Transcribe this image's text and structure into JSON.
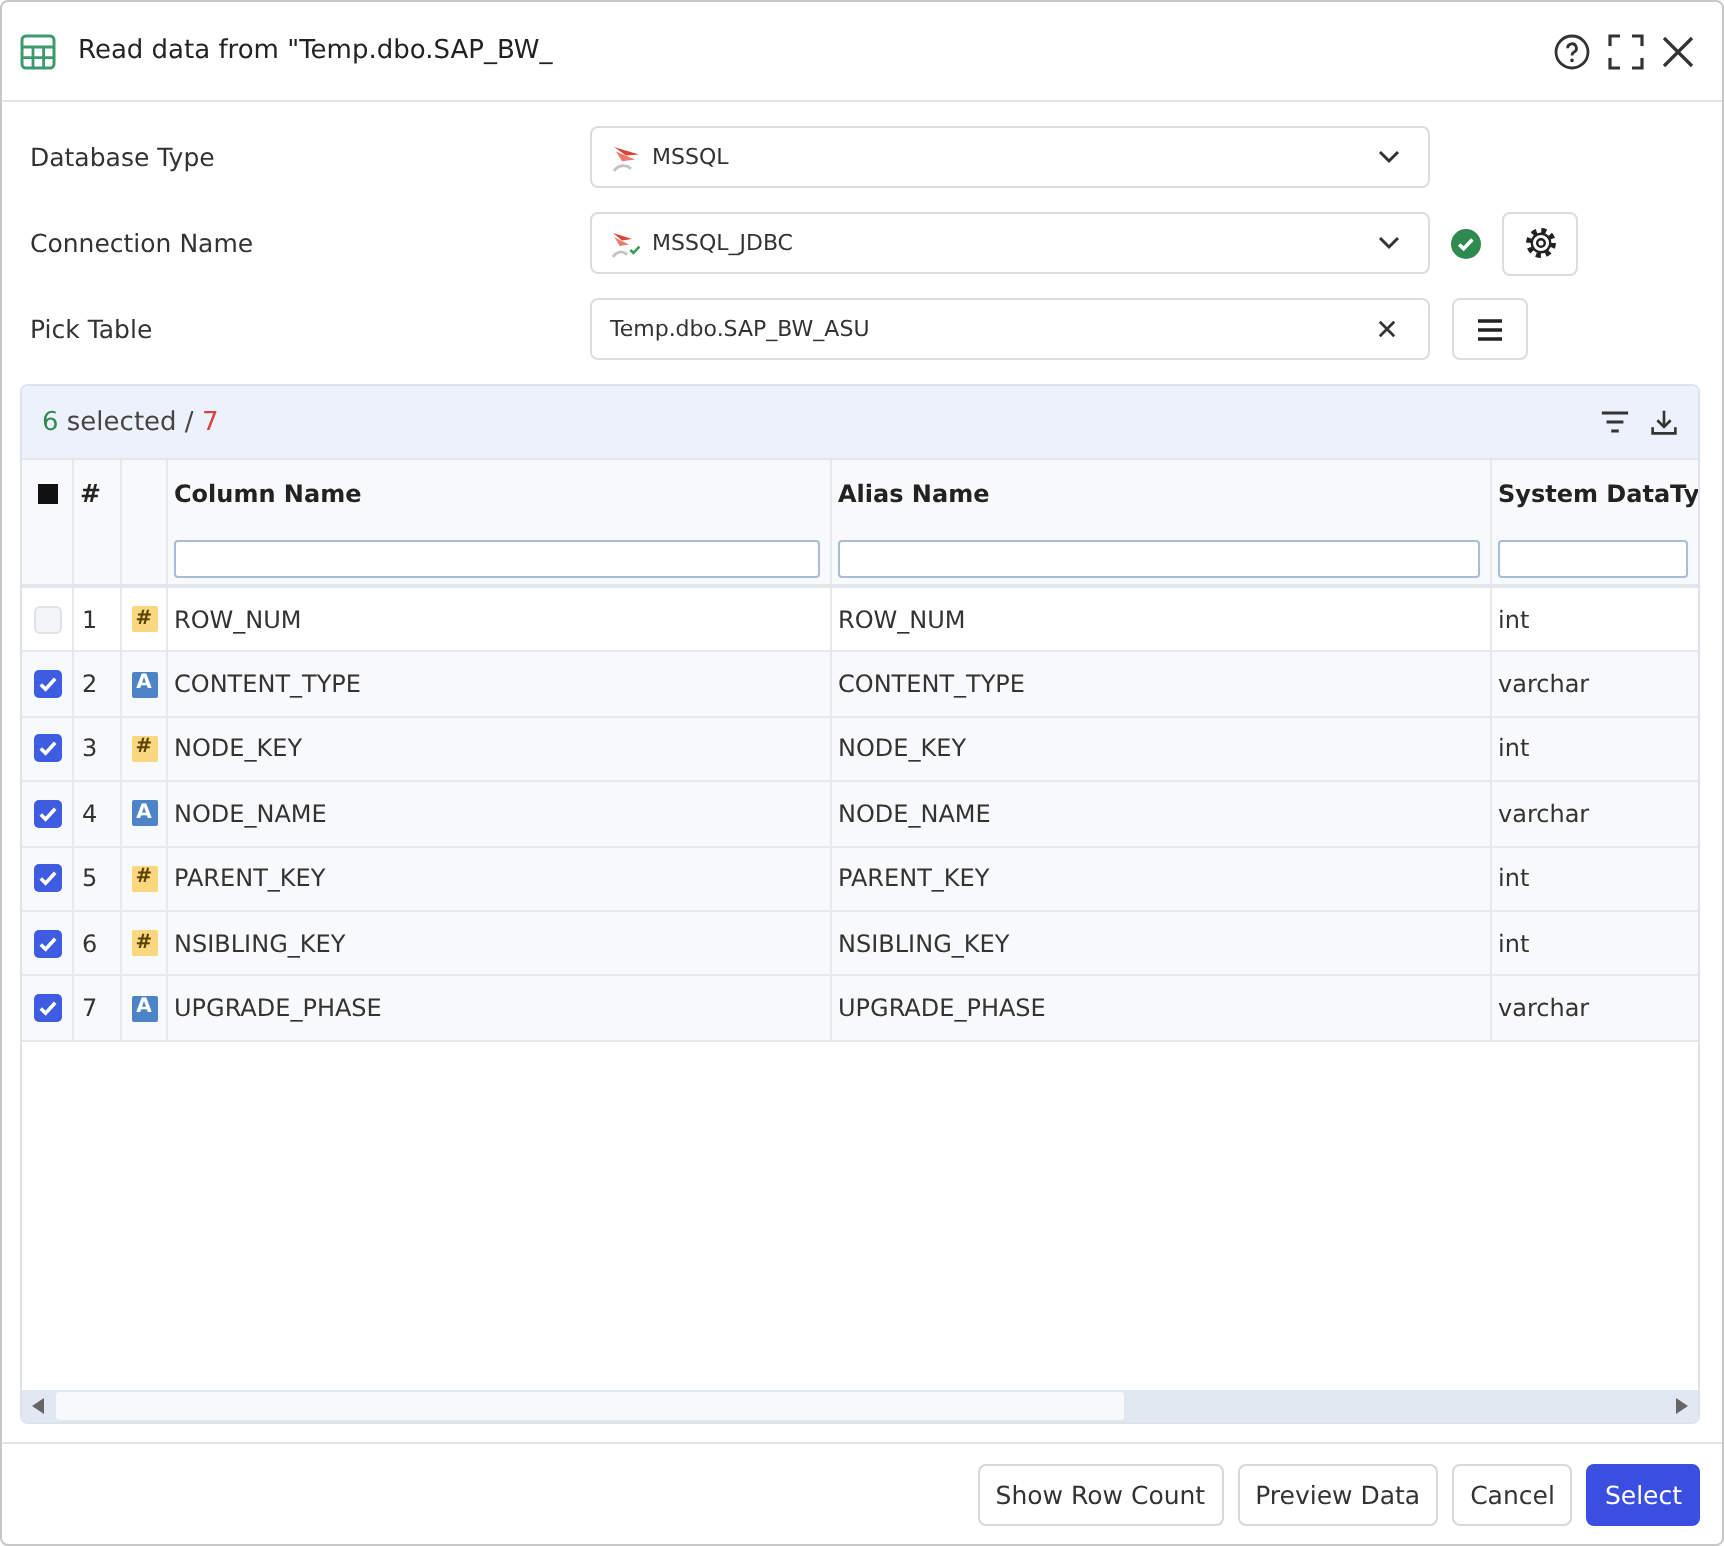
{
  "window": {
    "title": "Read data from \"Temp.dbo.SAP_BW_"
  },
  "form": [
    {
      "kind": "database",
      "label": "Database Type",
      "value": "MSSQL"
    },
    {
      "kind": "connection",
      "label": "Connection Name",
      "value": "MSSQL_JDBC",
      "connected": true
    },
    {
      "kind": "table",
      "label": "Pick Table",
      "value": "Temp.dbo.SAP_BW_ASU"
    }
  ],
  "grid": {
    "selection": {
      "count": "6",
      "label": "selected /",
      "total": "7"
    },
    "select_all": {
      "indeterminate": true
    },
    "number_header": "#",
    "columns": [
      {
        "label": "Column Name"
      },
      {
        "label": "Alias Name"
      },
      {
        "label": "System DataTy"
      }
    ],
    "rows": [
      {
        "checked": false,
        "number": "1",
        "kind": "number",
        "type_symbol": "#",
        "column_name": "ROW_NUM",
        "alias_name": "ROW_NUM",
        "data_type": "int"
      },
      {
        "checked": true,
        "number": "2",
        "kind": "text",
        "type_symbol": "A",
        "column_name": "CONTENT_TYPE",
        "alias_name": "CONTENT_TYPE",
        "data_type": "varchar"
      },
      {
        "checked": true,
        "number": "3",
        "kind": "number",
        "type_symbol": "#",
        "column_name": "NODE_KEY",
        "alias_name": "NODE_KEY",
        "data_type": "int"
      },
      {
        "checked": true,
        "number": "4",
        "kind": "text",
        "type_symbol": "A",
        "column_name": "NODE_NAME",
        "alias_name": "NODE_NAME",
        "data_type": "varchar"
      },
      {
        "checked": true,
        "number": "5",
        "kind": "number",
        "type_symbol": "#",
        "column_name": "PARENT_KEY",
        "alias_name": "PARENT_KEY",
        "data_type": "int"
      },
      {
        "checked": true,
        "number": "6",
        "kind": "number",
        "type_symbol": "#",
        "column_name": "NSIBLING_KEY",
        "alias_name": "NSIBLING_KEY",
        "data_type": "int"
      },
      {
        "checked": true,
        "number": "7",
        "kind": "text",
        "type_symbol": "A",
        "column_name": "UPGRADE_PHASE",
        "alias_name": "UPGRADE_PHASE",
        "data_type": "varchar"
      }
    ]
  },
  "footer": {
    "buttons": [
      {
        "label": "Show Row Count",
        "primary": false
      },
      {
        "label": "Preview Data",
        "primary": false
      },
      {
        "label": "Cancel",
        "primary": false
      },
      {
        "label": "Select",
        "primary": true
      }
    ]
  }
}
